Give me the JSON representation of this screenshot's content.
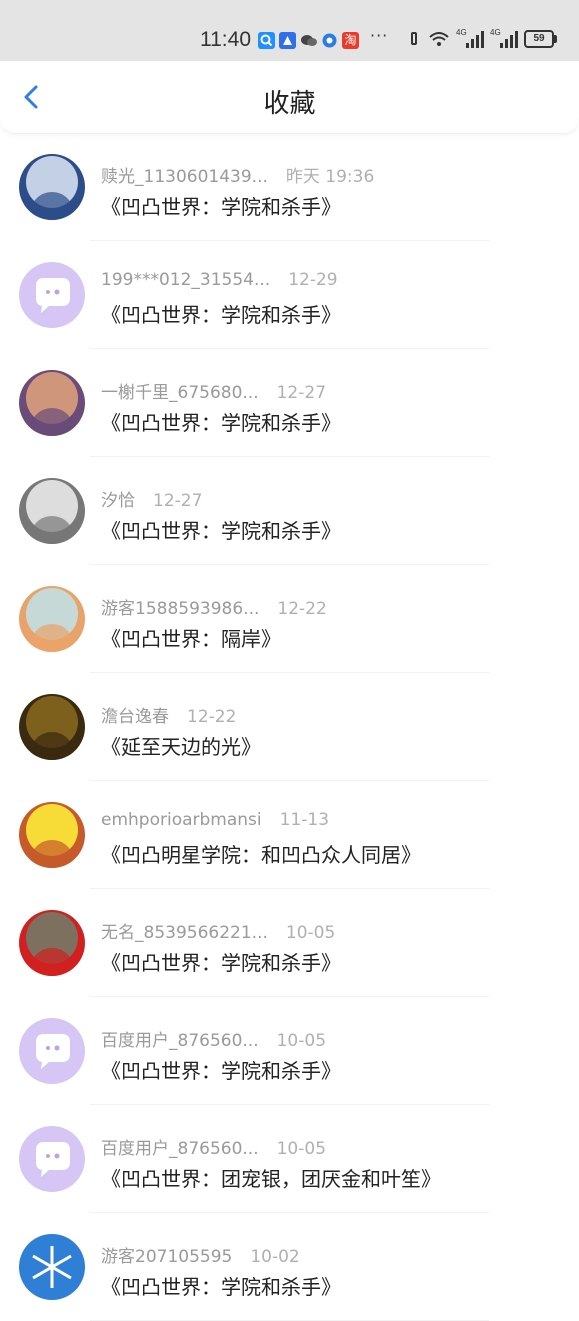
{
  "status_bar": {
    "time": "11:40",
    "more": "···",
    "battery": "59",
    "net1": "4G",
    "net2": "4G",
    "app_icon_names": [
      "search-app-icon",
      "drive-app-icon",
      "wechat-icon",
      "browser-icon",
      "taobao-icon"
    ],
    "app_icon_colors": [
      "#1e90ff",
      "#2f6fe8",
      "#333333",
      "#2a7de1",
      "#e93b2b"
    ],
    "taobao_label": "淘"
  },
  "header": {
    "title": "收藏",
    "accent_color": "#2c7fe6"
  },
  "items": [
    {
      "user": "赎光_1130601439...",
      "time": "昨天 19:36",
      "work": "《凹凸世界：学院和杀手》",
      "avatar": "anime-girl-blue",
      "avatar_colors": [
        "#dfe8f4",
        "#2d4d8a"
      ]
    },
    {
      "user": "199***012_31554...",
      "time": "12-29",
      "work": "《凹凸世界：学院和杀手》",
      "avatar": "default-chat-avatar",
      "avatar_colors": [
        "#d6c6f5",
        "#ffffff"
      ]
    },
    {
      "user": "一榭千里_675680...",
      "time": "12-27",
      "work": "《凹凸世界：学院和杀手》",
      "avatar": "sunset-scene",
      "avatar_colors": [
        "#e2a37b",
        "#6a4b7a"
      ]
    },
    {
      "user": "汐恰",
      "time": "12-27",
      "work": "《凹凸世界：学院和杀手》",
      "avatar": "anime-girl-silver",
      "avatar_colors": [
        "#eeeeee",
        "#777777"
      ]
    },
    {
      "user": "游客1588593986...",
      "time": "12-22",
      "work": "《凹凸世界：隔岸》",
      "avatar": "cartoon-deer",
      "avatar_colors": [
        "#bfe3ea",
        "#e9a36a"
      ]
    },
    {
      "user": "澹台逸春",
      "time": "12-22",
      "work": "《延至天边的光》",
      "avatar": "autumn-forest",
      "avatar_colors": [
        "#8a6a1e",
        "#3a2a10"
      ]
    },
    {
      "user": "emhporioarbmansi",
      "time": "11-13",
      "work": "《凹凸明星学院：和凹凸众人同居》",
      "avatar": "basketball-boy",
      "avatar_colors": [
        "#fff23a",
        "#c65a2a"
      ]
    },
    {
      "user": "无名_8539566221...",
      "time": "10-05",
      "work": "《凹凸世界：学院和杀手》",
      "avatar": "santa-hat-figure",
      "avatar_colors": [
        "#6e7f6a",
        "#d22020"
      ]
    },
    {
      "user": "百度用户_876560...",
      "time": "10-05",
      "work": "《凹凸世界：学院和杀手》",
      "avatar": "default-chat-avatar",
      "avatar_colors": [
        "#d6c6f5",
        "#ffffff"
      ]
    },
    {
      "user": "百度用户_876560...",
      "time": "10-05",
      "work": "《凹凸世界：团宠银，团厌金和叶笙》",
      "avatar": "default-chat-avatar",
      "avatar_colors": [
        "#d6c6f5",
        "#ffffff"
      ]
    },
    {
      "user": "游客207105595",
      "time": "10-02",
      "work": "《凹凸世界：学院和杀手》",
      "avatar": "snowflake",
      "avatar_colors": [
        "#2f7fd6",
        "#ffffff"
      ]
    }
  ]
}
